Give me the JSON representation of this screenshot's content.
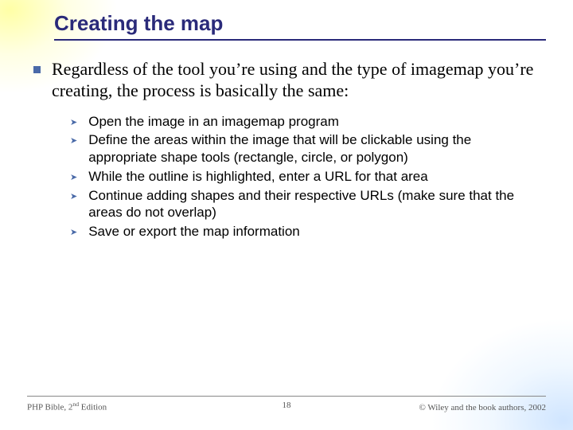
{
  "title": "Creating the map",
  "lead": "Regardless of the tool you’re using and the type of imagemap you’re creating, the process is basically the same:",
  "sub": {
    "s0": "Open the image in an imagemap program",
    "s1": "Define the areas within the image that will be clickable using the appropriate shape tools (rectangle, circle, or polygon)",
    "s2": "While the outline is highlighted, enter a URL for that area",
    "s3": "Continue adding shapes and their respective URLs (make sure that the areas do not overlap)",
    "s4": "Save or export the map information"
  },
  "footer": {
    "left_pre": "PHP Bible, 2",
    "left_sup": "nd",
    "left_post": " Edition",
    "page": "18",
    "right": "© Wiley and the book authors, 2002"
  }
}
